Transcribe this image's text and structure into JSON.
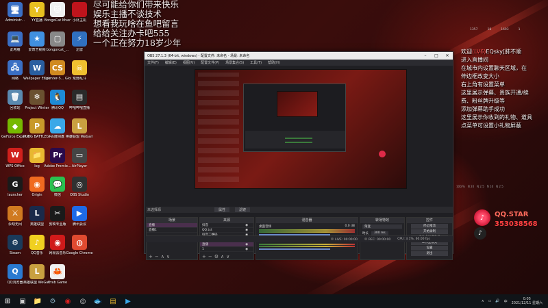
{
  "desktop_icons": [
    {
      "label": "Administr...",
      "name": "admin-folder-icon",
      "glyph": "🖥",
      "color": "#3a6fc4"
    },
    {
      "label": "YY直播",
      "name": "yy-icon",
      "glyph": "Y",
      "color": "#e8c020"
    },
    {
      "label": "BongoCat Mver",
      "name": "bongocat-icon",
      "glyph": "🐱",
      "color": "#f0f0f0"
    },
    {
      "label": "小虾主机",
      "name": "shrimp-icon",
      "glyph": "",
      "color": "#c0141c"
    },
    {
      "label": "此电脑",
      "name": "this-pc-icon",
      "glyph": "💻",
      "color": "#3a6fc4"
    },
    {
      "label": "爱奇艺视频",
      "name": "iqiyi-icon",
      "glyph": "★",
      "color": "#4090e0"
    },
    {
      "label": "bongorcat_...",
      "name": "bongocat2-icon",
      "glyph": "▢",
      "color": "#888888"
    },
    {
      "label": "迅雷",
      "name": "xunlei-icon",
      "glyph": "⚡",
      "color": "#3070c0"
    },
    {
      "label": "网络",
      "name": "network-icon",
      "glyph": "🖧",
      "color": "#3a6fc4"
    },
    {
      "label": "Wallpaper Engine...",
      "name": "wallpaper-engine-icon",
      "glyph": "W",
      "color": "#2a5fa0"
    },
    {
      "label": "Counter-S... Global Off...",
      "name": "csgo-icon",
      "glyph": "CS",
      "color": "#d08a20"
    },
    {
      "label": "荒野乱斗",
      "name": "brawl-icon",
      "glyph": "☠",
      "color": "#f0c030"
    },
    {
      "label": "回收站",
      "name": "recycle-bin-icon",
      "glyph": "🗑",
      "color": "#5a8ab0"
    },
    {
      "label": "Project Winter",
      "name": "project-winter-icon",
      "glyph": "❄",
      "color": "#6a5030"
    },
    {
      "label": "腾讯QQ",
      "name": "qq-icon",
      "glyph": "🐧",
      "color": "#1e8ad6"
    },
    {
      "label": "哔哩哔哩直播",
      "name": "bilibili-icon",
      "glyph": "▤",
      "color": "#2a2a2a"
    },
    {
      "label": "GeForce Experience",
      "name": "geforce-icon",
      "glyph": "◆",
      "color": "#76b900"
    },
    {
      "label": "PUBG BATTLEGR...",
      "name": "pubg-icon",
      "glyph": "P",
      "color": "#c89a2a"
    },
    {
      "label": "百度网盘",
      "name": "baidu-pan-icon",
      "glyph": "☁",
      "color": "#3aa8e8"
    },
    {
      "label": "英雄联盟 WeGame版",
      "name": "lol-wegame-icon",
      "glyph": "L",
      "color": "#c9a040"
    },
    {
      "label": "WPS Office",
      "name": "wps-icon",
      "glyph": "W",
      "color": "#d0201c"
    },
    {
      "label": "log",
      "name": "log-folder-icon",
      "glyph": "📁",
      "color": "#e8b830"
    },
    {
      "label": "Adobe Premie...",
      "name": "premiere-icon",
      "glyph": "Pr",
      "color": "#2a0a4a"
    },
    {
      "label": "AirPlayer",
      "name": "airplayer-icon",
      "glyph": "▭",
      "color": "#444444"
    },
    {
      "label": "launcher",
      "name": "launcher-icon",
      "glyph": "G",
      "color": "#1a1a1a"
    },
    {
      "label": "Origin",
      "name": "origin-icon",
      "glyph": "◉",
      "color": "#f06a20"
    },
    {
      "label": "微信",
      "name": "wechat-icon",
      "glyph": "💬",
      "color": "#2ac050"
    },
    {
      "label": "OBS Studio",
      "name": "obs-icon",
      "glyph": "◎",
      "color": "#303030"
    },
    {
      "label": "永劫无间",
      "name": "naraka-icon",
      "glyph": "⚔",
      "color": "#d07a20"
    },
    {
      "label": "英雄联盟",
      "name": "lol-icon",
      "glyph": "L",
      "color": "#1a2a4a"
    },
    {
      "label": "剪映专业版",
      "name": "capcut-icon",
      "glyph": "✂",
      "color": "#1a1a1a"
    },
    {
      "label": "腾讯会议",
      "name": "tencent-meeting-icon",
      "glyph": "▶",
      "color": "#1e6ae8"
    },
    {
      "label": "Steam",
      "name": "steam-icon",
      "glyph": "⚙",
      "color": "#1a3a5a"
    },
    {
      "label": "QQ音乐",
      "name": "qq-music-icon",
      "glyph": "♪",
      "color": "#f0d020"
    },
    {
      "label": "网易云音乐",
      "name": "netease-music-icon",
      "glyph": "◉",
      "color": "#d01a1a"
    },
    {
      "label": "Google Chrome",
      "name": "chrome-icon",
      "glyph": "◍",
      "color": "#e04a30"
    },
    {
      "label": "QQ浏览器",
      "name": "qq-browser-icon",
      "glyph": "Q",
      "color": "#2a7ad0"
    },
    {
      "label": "英雄联盟 WeGame版",
      "name": "lol-wegame2-icon",
      "glyph": "L",
      "color": "#c9a040"
    },
    {
      "label": "Crab Game",
      "name": "crab-game-icon",
      "glyph": "🦀",
      "color": "#f0f0f0"
    }
  ],
  "overlay_text": [
    "尽可能给你们带来快乐",
    "娱乐主播不谈技术",
    "想看我玩啥在鱼吧留言",
    "给给关注办卡吧555",
    "一个正在努力18岁少年"
  ],
  "obs": {
    "title": "OBS 27.1.3 (64-bit, windows) - 配置文件: 未命名 - 场景: 未命名",
    "menu": [
      "文件(F)",
      "编辑(E)",
      "视图(V)",
      "配置文件(P)",
      "场景集合(S)",
      "工具(T)",
      "帮助(H)"
    ],
    "scene_bar_label": "未选择源",
    "scene_bar_props": "属性",
    "scene_bar_filters": "滤镜",
    "docks": {
      "scenes": {
        "title": "场景",
        "items": [
          "直播",
          "直播1"
        ]
      },
      "sources": {
        "title": "来源",
        "items": [
          "抖音",
          "QQ.txt",
          "抖音二维码",
          "mic",
          "直播",
          "1"
        ]
      },
      "mixer": {
        "title": "混音器",
        "tracks": [
          {
            "name": "桌面音频",
            "level": "0.0 dB"
          },
          {
            "name": "麦克风/Aux",
            "level": "-4.5 dB"
          }
        ]
      },
      "transitions": {
        "title": "转场特效",
        "type": "渐变",
        "duration_label": "时长",
        "duration": "300 ms"
      },
      "controls": {
        "title": "控件",
        "buttons": [
          "停止推流",
          "开始录制",
          "启动虚拟摄像机",
          "工作室模式",
          "设置",
          "退出"
        ]
      }
    },
    "status": {
      "live": "LIVE: 00:00:00",
      "rec": "REC: 00:00:00",
      "cpu": "CPU: 3.1%, 60.00 fps"
    }
  },
  "chat": {
    "stats": [
      "1357",
      "18",
      "1693",
      "1"
    ],
    "messages": [
      {
        "prefix": "欢迎",
        "highlight": "(LV6)",
        "text": "EQsky[肺不顺",
        "mixed": true
      },
      {
        "text": "进入直播间"
      },
      {
        "text": "在城市内设置聊天区域，在"
      },
      {
        "text": "伸边框改变大小"
      },
      {
        "text": "右上角有设置菜单"
      },
      {
        "text": "这里展示弹幕、贵族开通/续"
      },
      {
        "text": "费、粉丝牌升级等"
      },
      {
        "text": "添加弹幕助手成功"
      },
      {
        "text": "这里展示你收到的礼物、道具"
      },
      {
        "text": ""
      },
      {
        "text": "点菜单可设置小礼物屏蔽"
      }
    ],
    "tags": [
      "100/%",
      "N 20",
      "N 2.5",
      "N 10",
      "N 2.5"
    ]
  },
  "qq_badge": {
    "label": "QQ.STAR",
    "number": "353038568"
  },
  "taskbar": {
    "icons": [
      "windows-start-icon",
      "task-view-icon",
      "file-explorer-icon",
      "steam-taskbar-icon",
      "netease-taskbar-icon",
      "obs-taskbar-icon",
      "douyu-taskbar-icon",
      "folder-taskbar-icon",
      "bilibili-taskbar-icon"
    ],
    "time": "0:05",
    "date": "2021/12/11 星期六"
  }
}
